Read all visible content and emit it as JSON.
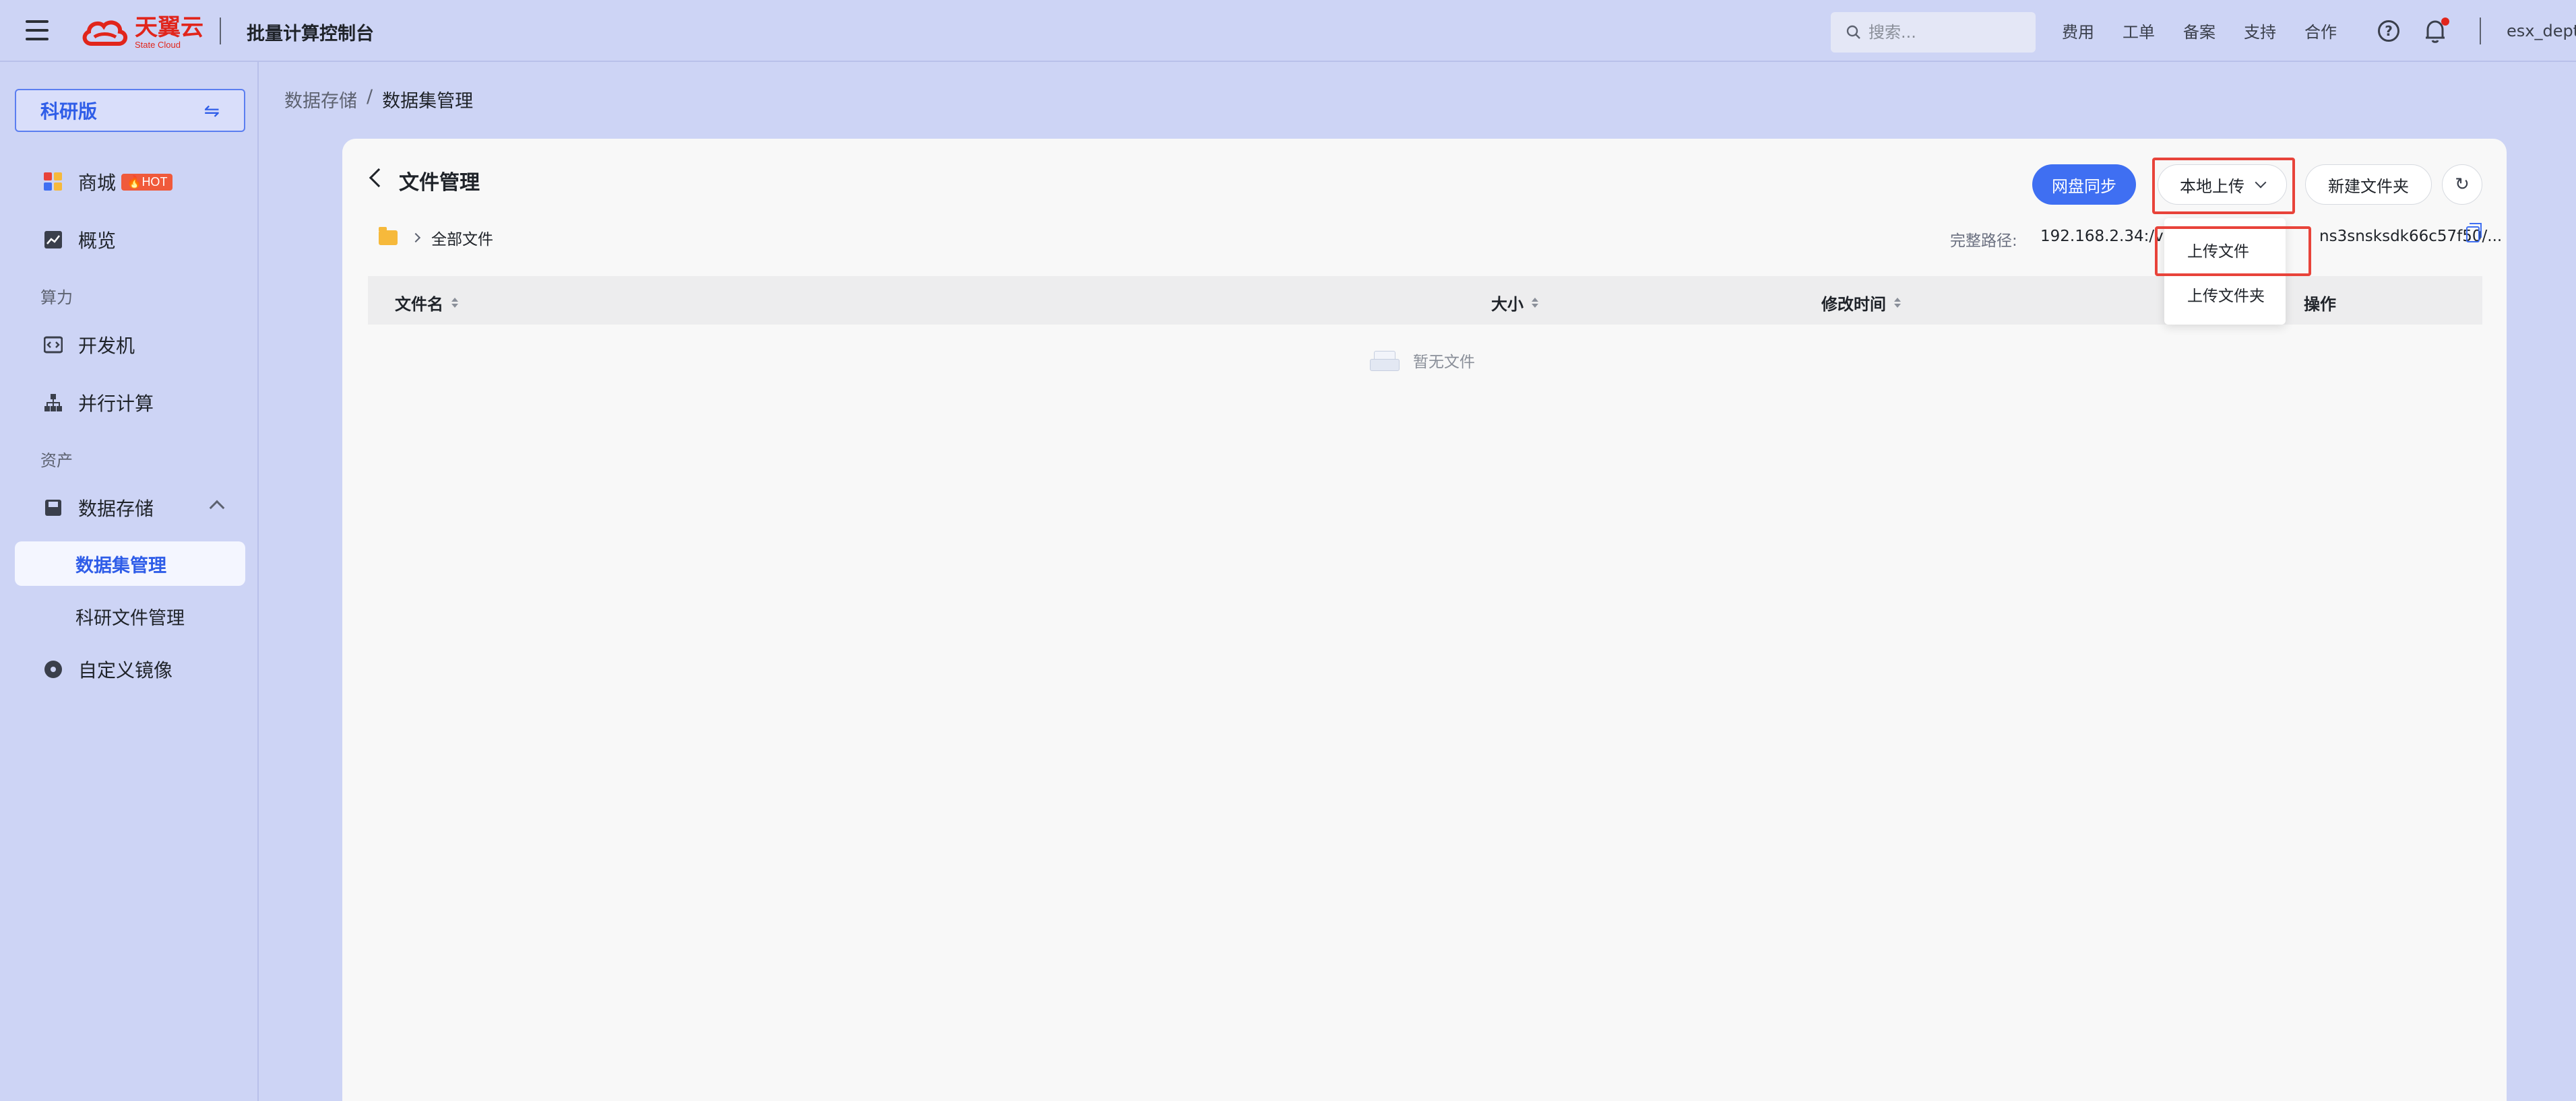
{
  "topbar": {
    "logo_cn": "天翼云",
    "logo_en": "State Cloud",
    "console_title": "批量计算控制台",
    "search_placeholder": "搜索...",
    "nav_links": [
      "费用",
      "工单",
      "备案",
      "支持",
      "合作"
    ],
    "user": "esx_dept",
    "accent": "#e1251b"
  },
  "sidebar": {
    "edition": "科研版",
    "items": {
      "mall": "商城",
      "mall_badge": "HOT",
      "overview": "概览",
      "group_compute": "算力",
      "devbox": "开发机",
      "parallel": "并行计算",
      "group_assets": "资产",
      "storage": "数据存储",
      "dataset_mgmt": "数据集管理",
      "research_files": "科研文件管理",
      "custom_image": "自定义镜像"
    }
  },
  "breadcrumb": {
    "parent": "数据存储",
    "sep": "/",
    "current": "数据集管理"
  },
  "main": {
    "title": "文件管理",
    "buttons": {
      "sync": "网盘同步",
      "upload": "本地上传",
      "new_folder": "新建文件夹"
    },
    "path": {
      "root": "全部文件",
      "full_label": "完整路径:",
      "full_value": "192.168.2.34:/var/",
      "full_tail": "ns3snsksdk66c57f50/..."
    },
    "table": {
      "columns": [
        "文件名",
        "大小",
        "修改时间",
        "操作"
      ],
      "empty_text": "暂无文件"
    },
    "upload_menu": [
      "上传文件",
      "上传文件夹"
    ],
    "primary_color": "#3f6ff2",
    "highlight_color": "#e8433a"
  }
}
